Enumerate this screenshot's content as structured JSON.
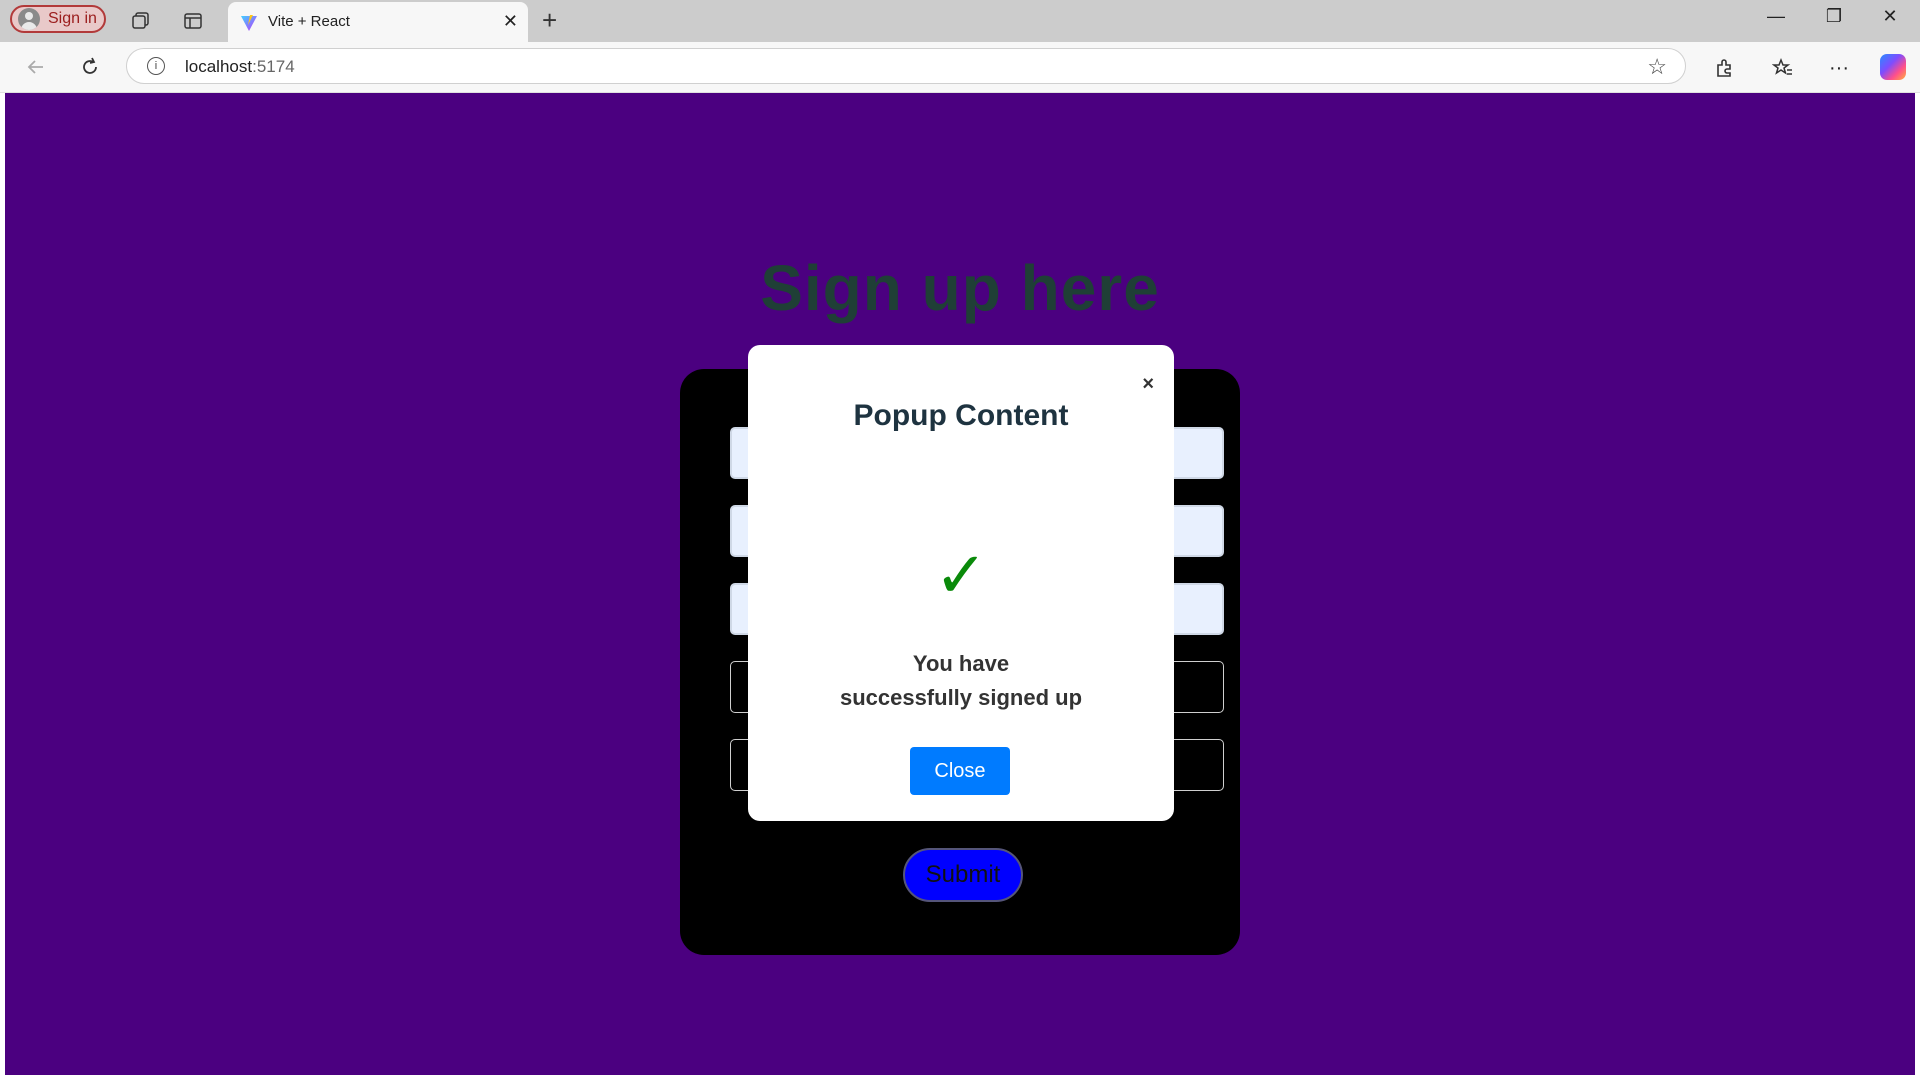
{
  "browser": {
    "signin_label": "Sign in",
    "tab_title": "Vite + React",
    "tab_close": "✕",
    "new_tab": "+",
    "url_host": "localhost",
    "url_port": ":5174",
    "window_controls": {
      "minimize": "—",
      "restore": "❐",
      "close": "✕"
    },
    "icons": [
      "workspaces-icon",
      "tab-actions-icon",
      "back-icon",
      "refresh-icon",
      "info-icon",
      "favorite-star-icon",
      "extensions-icon",
      "favorites-icon",
      "more-icon",
      "copilot-icon"
    ]
  },
  "page": {
    "background": "#4b0080",
    "title": "Sign up here",
    "submit_label": "Submit"
  },
  "popup": {
    "close_x": "×",
    "title": "Popup Content",
    "check": "✓",
    "message_line1": "You have",
    "message_line2": "successfully signed up",
    "close_label": "Close",
    "button_color": "#007bff"
  }
}
